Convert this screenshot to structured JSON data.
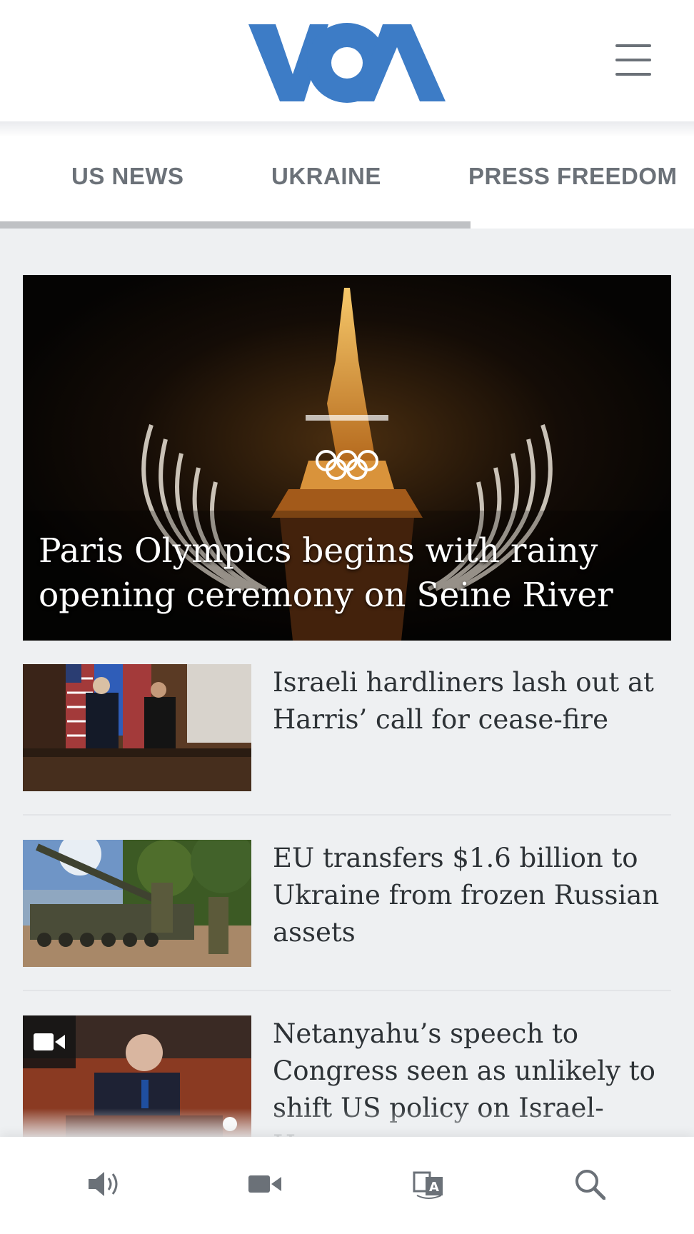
{
  "brand": {
    "logo_text": "VOA",
    "color": "#3d7cc6"
  },
  "tabs": [
    {
      "label": "US NEWS"
    },
    {
      "label": "UKRAINE"
    },
    {
      "label": "PRESS FREEDOM"
    }
  ],
  "hero": {
    "title": "Paris Olympics begins with rainy opening ceremony on Seine River"
  },
  "articles": [
    {
      "title": "Israeli hardliners lash out at Harris’ call for cease-fire",
      "has_video": false
    },
    {
      "title": "EU transfers $1.6 billion to Ukraine from frozen Russian assets",
      "has_video": false
    },
    {
      "title": "Netanyahu’s speech to Congress seen as unlikely to shift US policy on Israel-Hamas war",
      "has_video": true
    }
  ],
  "bottom_nav": [
    {
      "icon": "audio-icon"
    },
    {
      "icon": "video-camera-icon"
    },
    {
      "icon": "language-icon"
    },
    {
      "icon": "search-icon"
    }
  ],
  "colors": {
    "text": "#2d3236",
    "tab_text": "#6b7178",
    "background": "#eef0f2"
  }
}
